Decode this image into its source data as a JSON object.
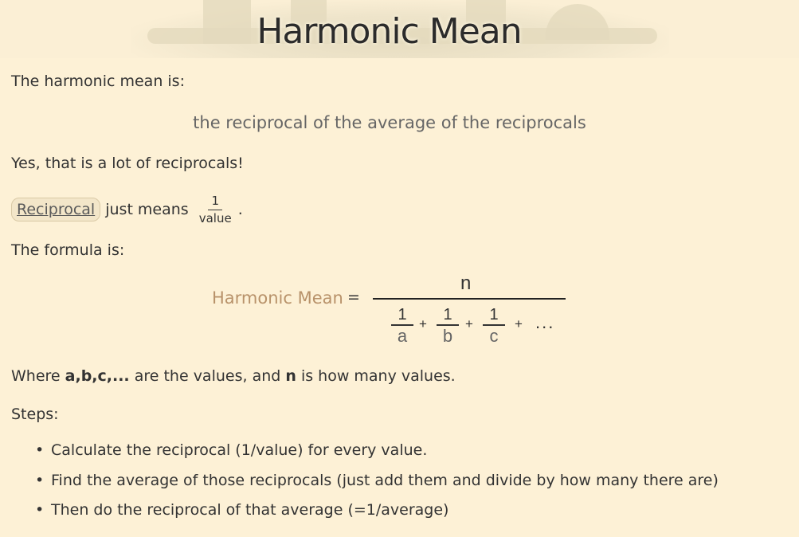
{
  "header": {
    "title": "Harmonic Mean"
  },
  "intro": "The harmonic mean is:",
  "definition": "the reciprocal of the average of the reciprocals",
  "remark": "Yes, that is a lot of reciprocals!",
  "reciprocal": {
    "link_text": "Reciprocal",
    "text": "just means",
    "frac_numerator": "1",
    "frac_denominator": "value",
    "trailing": "."
  },
  "formula_intro": "The formula is:",
  "formula": {
    "label": "Harmonic Mean",
    "equals": "=",
    "numerator": "n",
    "terms": [
      {
        "num": "1",
        "den": "a"
      },
      {
        "num": "1",
        "den": "b"
      },
      {
        "num": "1",
        "den": "c"
      }
    ],
    "plus": "+",
    "ellipsis": "..."
  },
  "where": {
    "prefix": "Where",
    "vars": "a,b,c,...",
    "middle": "are the values, and",
    "n": "n",
    "suffix": "is how many values."
  },
  "steps_label": "Steps:",
  "steps": [
    "Calculate the reciprocal (1/value) for every value.",
    "Find the average of those reciprocals (just add them and divide by how many there are)",
    "Then do the reciprocal of that average (=1/average)"
  ],
  "colors": {
    "background": "#fdf1d6",
    "accent": "#b8926a",
    "text": "#333333",
    "muted": "#666666"
  }
}
